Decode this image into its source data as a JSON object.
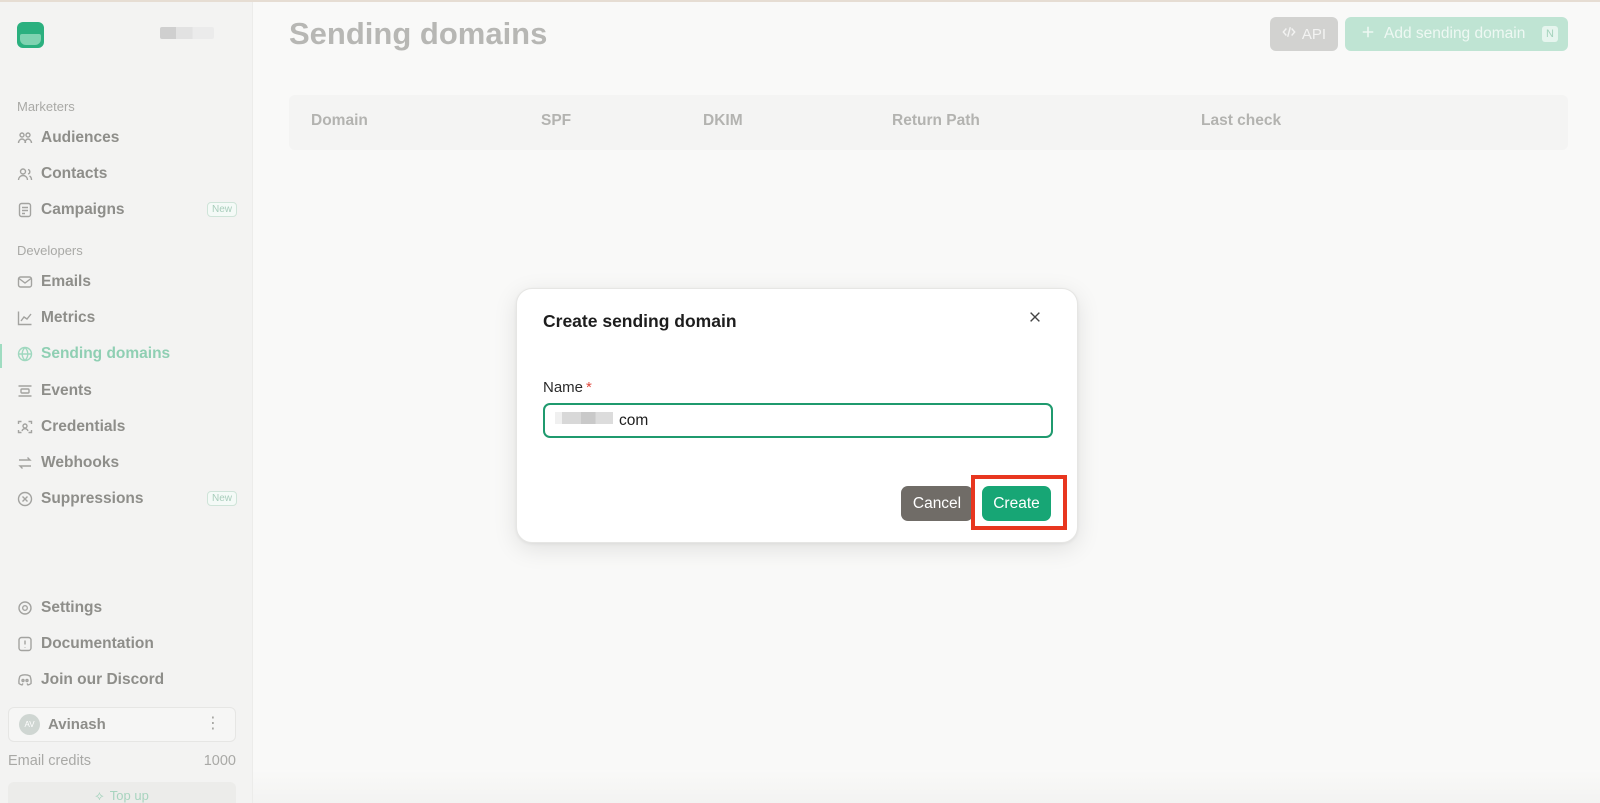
{
  "sidebar": {
    "sections": [
      {
        "label": "Marketers"
      },
      {
        "label": "Developers"
      }
    ],
    "items": [
      {
        "label": "Audiences",
        "icon": "audiences-icon"
      },
      {
        "label": "Contacts",
        "icon": "contacts-icon"
      },
      {
        "label": "Campaigns",
        "icon": "campaigns-icon",
        "badge": "New"
      },
      {
        "label": "Emails",
        "icon": "mail-icon"
      },
      {
        "label": "Metrics",
        "icon": "chart-line-icon"
      },
      {
        "label": "Sending domains",
        "icon": "globe-icon",
        "active": true
      },
      {
        "label": "Events",
        "icon": "events-icon"
      },
      {
        "label": "Credentials",
        "icon": "credentials-icon"
      },
      {
        "label": "Webhooks",
        "icon": "webhooks-icon"
      },
      {
        "label": "Suppressions",
        "icon": "suppressions-icon",
        "badge": "New"
      },
      {
        "label": "Settings",
        "icon": "gear-icon"
      },
      {
        "label": "Documentation",
        "icon": "documentation-icon"
      },
      {
        "label": "Join our Discord",
        "icon": "discord-icon"
      }
    ],
    "user": {
      "initials": "AV",
      "name": "Avinash"
    },
    "credits": {
      "label": "Email credits",
      "value": "1000"
    },
    "topup_label": "Top up"
  },
  "header": {
    "title": "Sending domains",
    "api_label": "API",
    "add_label": "Add sending domain",
    "add_shortcut": "N"
  },
  "table": {
    "columns": [
      "Domain",
      "SPF",
      "DKIM",
      "Return Path",
      "Last check"
    ]
  },
  "modal": {
    "title": "Create sending domain",
    "field_label": "Name",
    "required_mark": "*",
    "name_value": "com",
    "cancel_label": "Cancel",
    "create_label": "Create"
  },
  "colors": {
    "accent": "#17a675",
    "highlight": "#e8361f",
    "cancel": "#706c67"
  }
}
